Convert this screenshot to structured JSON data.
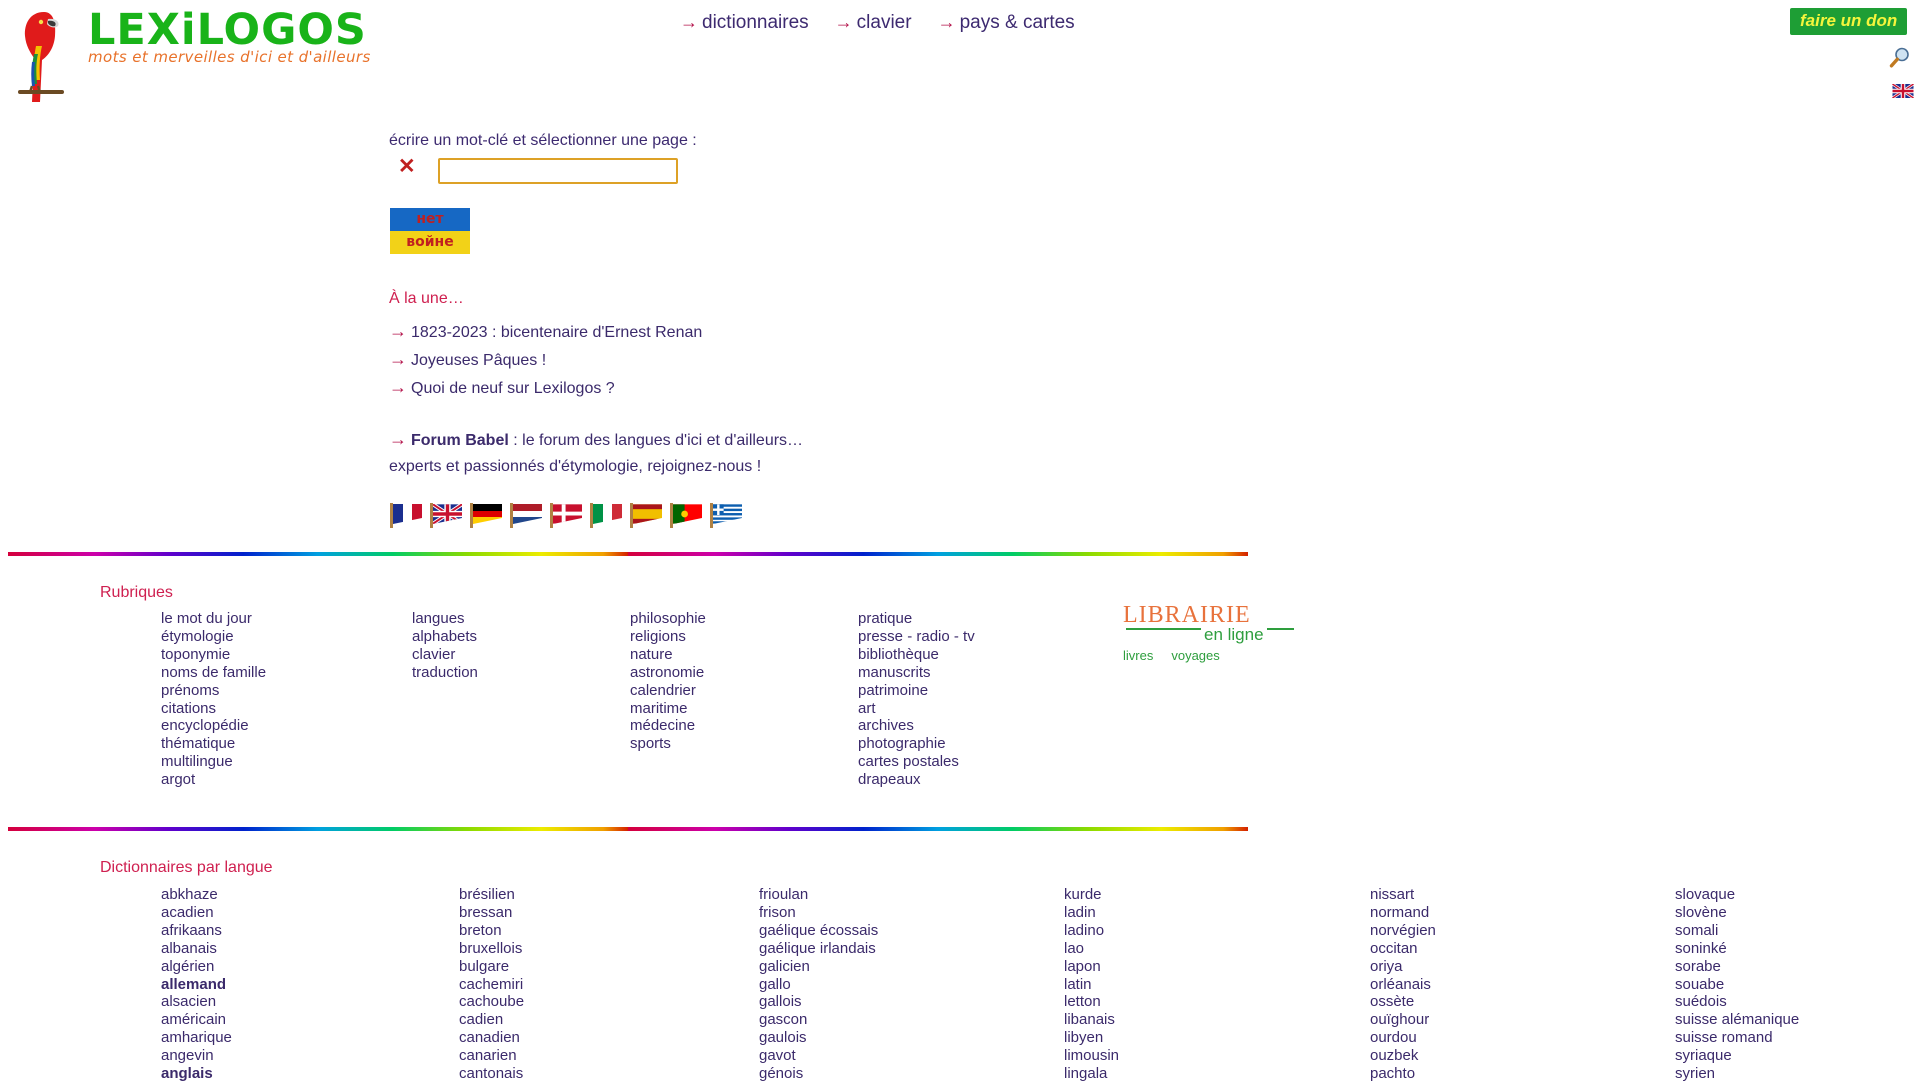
{
  "site": {
    "logo_word": "LEXiLOGOS",
    "logo_tagline": "mots et merveilles d'ici et d'ailleurs",
    "parrot_icon": "parrot-icon"
  },
  "header": {
    "nav": [
      {
        "label": "dictionnaires"
      },
      {
        "label": "clavier"
      },
      {
        "label": "pays & cartes"
      }
    ],
    "donate_label": "faire un don",
    "search_icon": "magnifier-icon",
    "language_flag": "uk-flag-icon"
  },
  "search": {
    "label": "écrire un mot-clé et sélectionner une page :",
    "clear_label": "✕",
    "value": "",
    "placeholder": ""
  },
  "ukraine_banner": {
    "line1": "нет",
    "line2": "войне",
    "blue": "#1668c4",
    "yellow": "#f2d218",
    "text_color": "#c02020"
  },
  "news": {
    "title": "À la une…",
    "items": [
      "1823-2023 : bicentenaire d'Ernest Renan",
      "Joyeuses Pâques !",
      "Quoi de neuf sur Lexilogos ?"
    ],
    "forum_bold": "Forum Babel",
    "forum_rest": ": le forum des langues d'ici et d'ailleurs…",
    "forum_line2": "experts et passionnés d'étymologie, rejoignez-nous !"
  },
  "flags": [
    {
      "name": "france-flag",
      "type": "v3",
      "colors": [
        "#1b2f8f",
        "#ffffff",
        "#c8102e"
      ]
    },
    {
      "name": "uk-flag",
      "type": "uk",
      "colors": [
        "#1b2f8f",
        "#ffffff",
        "#c8102e"
      ]
    },
    {
      "name": "germany-flag",
      "type": "h3",
      "colors": [
        "#000000",
        "#dd0000",
        "#ffce00"
      ]
    },
    {
      "name": "netherlands-flag",
      "type": "h3",
      "colors": [
        "#ae1c28",
        "#ffffff",
        "#21468b"
      ]
    },
    {
      "name": "denmark-flag",
      "type": "nordic",
      "colors": [
        "#c8102e",
        "#ffffff",
        "#c8102e"
      ]
    },
    {
      "name": "italy-flag",
      "type": "v3",
      "colors": [
        "#009246",
        "#ffffff",
        "#ce2b37"
      ]
    },
    {
      "name": "spain-flag",
      "type": "h3",
      "colors": [
        "#aa151b",
        "#f1bf00",
        "#aa151b"
      ]
    },
    {
      "name": "portugal-flag",
      "type": "pt",
      "colors": [
        "#006600",
        "#ff0000",
        "#ffcc00"
      ]
    },
    {
      "name": "greece-flag",
      "type": "gr",
      "colors": [
        "#0d5eaf",
        "#ffffff",
        "#0d5eaf"
      ]
    }
  ],
  "rubriques": {
    "title": "Rubriques",
    "columns": [
      [
        "le mot du jour",
        "étymologie",
        "toponymie",
        "noms de famille",
        "prénoms",
        "citations",
        "encyclopédie",
        "thématique",
        "multilingue",
        "argot"
      ],
      [
        "langues",
        "alphabets",
        "clavier",
        "traduction"
      ],
      [
        "philosophie",
        "religions",
        "nature",
        "astronomie",
        "calendrier",
        "maritime",
        "médecine",
        "sports"
      ],
      [
        "pratique",
        "presse - radio - tv",
        "bibliothèque",
        "manuscrits",
        "patrimoine",
        "art",
        "archives",
        "photographie",
        "cartes postales",
        "drapeaux"
      ]
    ]
  },
  "librairie": {
    "word": "LIBRAIRIE",
    "subtitle": "en ligne",
    "links": [
      "livres",
      "voyages"
    ],
    "word_color": "#e8723c",
    "subtitle_color": "#2e9e3e"
  },
  "dictionnaires": {
    "title": "Dictionnaires par langue",
    "columns": [
      [
        "abkhaze",
        "acadien",
        "afrikaans",
        "albanais",
        "algérien",
        "allemand",
        "alsacien",
        "américain",
        "amharique",
        "angevin",
        "anglais"
      ],
      [
        "brésilien",
        "bressan",
        "breton",
        "bruxellois",
        "bulgare",
        "cachemiri",
        "cachoube",
        "cadien",
        "canadien",
        "canarien",
        "cantonais"
      ],
      [
        "frioulan",
        "frison",
        "gaélique écossais",
        "gaélique irlandais",
        "galicien",
        "gallo",
        "gallois",
        "gascon",
        "gaulois",
        "gavot",
        "génois"
      ],
      [
        "kurde",
        "ladin",
        "ladino",
        "lao",
        "lapon",
        "latin",
        "letton",
        "libanais",
        "libyen",
        "limousin",
        "lingala"
      ],
      [
        "nissart",
        "normand",
        "norvégien",
        "occitan",
        "oriya",
        "orléanais",
        "ossète",
        "ouïghour",
        "ourdou",
        "ouzbek",
        "pachto"
      ],
      [
        "slovaque",
        "slovène",
        "somali",
        "soninké",
        "sorabe",
        "souabe",
        "suédois",
        "suisse alémanique",
        "suisse romand",
        "syriaque",
        "syrien"
      ]
    ],
    "bold_items": [
      "allemand",
      "anglais"
    ]
  },
  "colors": {
    "link": "#4b2d7f",
    "heading": "#cf2050",
    "arrow": "#b3124a",
    "logo_green": "#19b319",
    "tagline_orange": "#e8722b",
    "donate_bg": "#1e9e35",
    "donate_text": "#f5f53c",
    "input_border": "#dda126"
  }
}
